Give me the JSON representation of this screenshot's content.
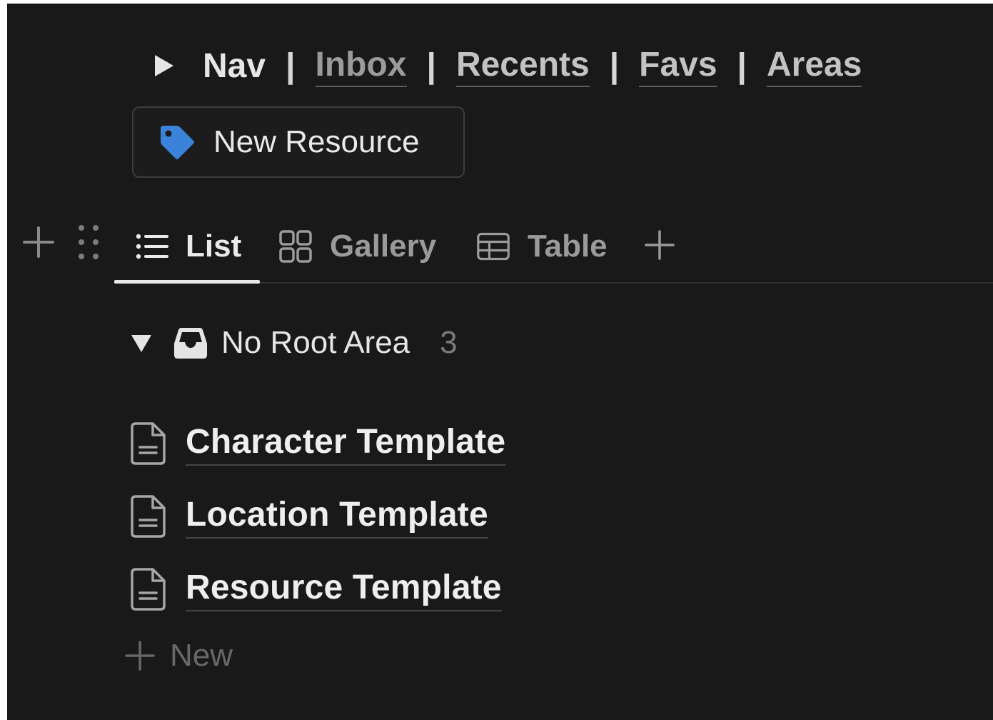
{
  "nav": {
    "label": "Nav",
    "separator": "|",
    "links": [
      "Inbox",
      "Recents",
      "Favs",
      "Areas"
    ]
  },
  "toolbar": {
    "new_resource_label": "New Resource",
    "new_resource_icon": "tag-icon"
  },
  "tabs": [
    {
      "label": "List",
      "icon": "list-icon",
      "active": true
    },
    {
      "label": "Gallery",
      "icon": "gallery-icon",
      "active": false
    },
    {
      "label": "Table",
      "icon": "table-icon",
      "active": false
    }
  ],
  "group": {
    "name": "No Root Area",
    "count": "3",
    "icon": "inbox-icon"
  },
  "items": [
    {
      "title": "Character Template",
      "icon": "document-icon"
    },
    {
      "title": "Location Template",
      "icon": "document-icon"
    },
    {
      "title": "Resource Template",
      "icon": "document-icon"
    }
  ],
  "new_row_label": "New",
  "colors": {
    "background": "#191919",
    "tag_icon": "#3b82d9",
    "text": "#eeeeee",
    "muted_text": "#7a7a7a"
  }
}
